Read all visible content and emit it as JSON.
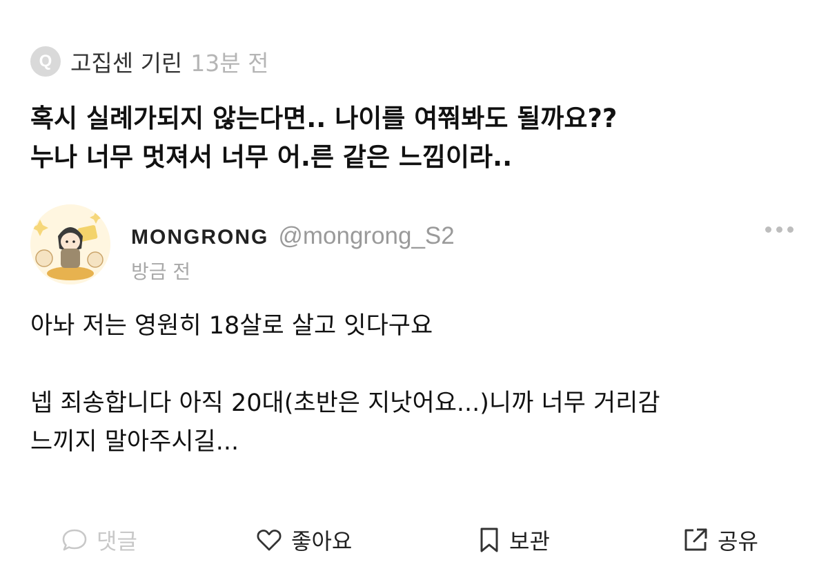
{
  "question": {
    "icon_letter": "Q",
    "asker_name": "고집센 기린",
    "time": "13분 전",
    "lines": [
      "혹시 실례가되지 않는다면.. 나이를 여쭤봐도 될까요??",
      "누나 너무 멋져서 너무 어.른 같은 느낌이라.."
    ]
  },
  "answer": {
    "author_name": "MONGRONG",
    "author_handle": "@mongrong_S2",
    "time": "방금 전",
    "paragraphs": [
      [
        "아놔 저는 영원히 18살로 살고 잇다구요"
      ],
      [
        "넵 죄송합니다 아직 20대(초반은 지낫어요...)니까 너무 거리감",
        "느끼지 말아주시길..."
      ]
    ]
  },
  "actions": {
    "comment": {
      "label": "댓글",
      "icon": "speech-bubble-icon",
      "enabled": false
    },
    "like": {
      "label": "좋아요",
      "icon": "heart-icon",
      "enabled": true
    },
    "save": {
      "label": "보관",
      "icon": "bookmark-icon",
      "enabled": true
    },
    "share": {
      "label": "공유",
      "icon": "share-icon",
      "enabled": true
    }
  },
  "colors": {
    "text": "#111111",
    "muted": "#b5b5b5",
    "handle": "#9a9a9a",
    "disabled": "#c8c8c8",
    "q_badge": "#d9d9d9"
  }
}
